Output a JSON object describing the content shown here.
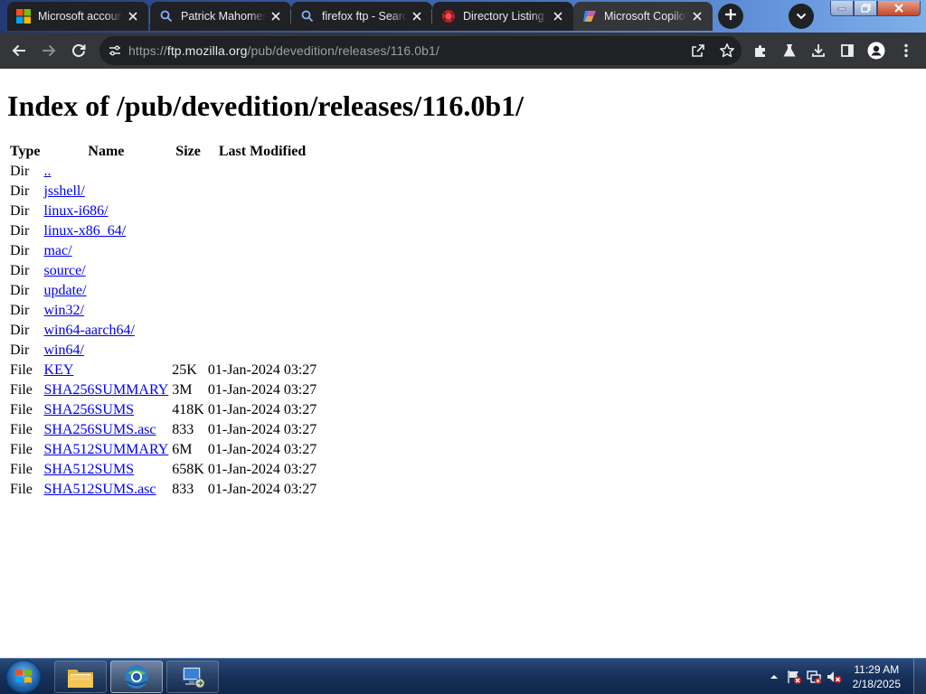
{
  "browser": {
    "tabs": [
      {
        "title": "Microsoft account | Sign In",
        "favicon": "microsoft-logo-icon",
        "active": false
      },
      {
        "title": "Patrick Mahomes - Search",
        "favicon": "search-icon",
        "active": false
      },
      {
        "title": "firefox ftp - Search",
        "favicon": "search-icon",
        "active": false
      },
      {
        "title": "Directory Listing",
        "favicon": "firefox-ftp-icon",
        "active": false
      },
      {
        "title": "Microsoft Copilot",
        "favicon": "copilot-icon",
        "active": true
      }
    ],
    "url": {
      "scheme": "https://",
      "host": "ftp.mozilla.org",
      "path": "/pub/devedition/releases/116.0b1/"
    },
    "colors": {
      "tab_bg": "#202124",
      "active_tab_bg": "#35363a",
      "toolbar_bg": "#35363a",
      "omnibox_bg": "#202124"
    }
  },
  "page": {
    "heading": "Index of /pub/devedition/releases/116.0b1/",
    "columns": [
      "Type",
      "Name",
      "Size",
      "Last Modified"
    ],
    "rows": [
      {
        "type": "Dir",
        "name": "..",
        "size": "",
        "modified": ""
      },
      {
        "type": "Dir",
        "name": "jsshell/",
        "size": "",
        "modified": ""
      },
      {
        "type": "Dir",
        "name": "linux-i686/",
        "size": "",
        "modified": ""
      },
      {
        "type": "Dir",
        "name": "linux-x86_64/",
        "size": "",
        "modified": ""
      },
      {
        "type": "Dir",
        "name": "mac/",
        "size": "",
        "modified": ""
      },
      {
        "type": "Dir",
        "name": "source/",
        "size": "",
        "modified": ""
      },
      {
        "type": "Dir",
        "name": "update/",
        "size": "",
        "modified": ""
      },
      {
        "type": "Dir",
        "name": "win32/",
        "size": "",
        "modified": ""
      },
      {
        "type": "Dir",
        "name": "win64-aarch64/",
        "size": "",
        "modified": ""
      },
      {
        "type": "Dir",
        "name": "win64/",
        "size": "",
        "modified": ""
      },
      {
        "type": "File",
        "name": "KEY",
        "size": "25K",
        "modified": "01-Jan-2024 03:27"
      },
      {
        "type": "File",
        "name": "SHA256SUMMARY",
        "size": "3M",
        "modified": "01-Jan-2024 03:27"
      },
      {
        "type": "File",
        "name": "SHA256SUMS",
        "size": "418K",
        "modified": "01-Jan-2024 03:27"
      },
      {
        "type": "File",
        "name": "SHA256SUMS.asc",
        "size": "833",
        "modified": "01-Jan-2024 03:27"
      },
      {
        "type": "File",
        "name": "SHA512SUMMARY",
        "size": "6M",
        "modified": "01-Jan-2024 03:27"
      },
      {
        "type": "File",
        "name": "SHA512SUMS",
        "size": "658K",
        "modified": "01-Jan-2024 03:27"
      },
      {
        "type": "File",
        "name": "SHA512SUMS.asc",
        "size": "833",
        "modified": "01-Jan-2024 03:27"
      }
    ],
    "link_color": "#0000ee"
  },
  "taskbar": {
    "apps": [
      {
        "name": "file-explorer",
        "active": false
      },
      {
        "name": "chrome",
        "active": true
      },
      {
        "name": "remote-desktop",
        "active": false
      }
    ],
    "clock": {
      "time": "11:29 AM",
      "date": "2/18/2025"
    }
  }
}
